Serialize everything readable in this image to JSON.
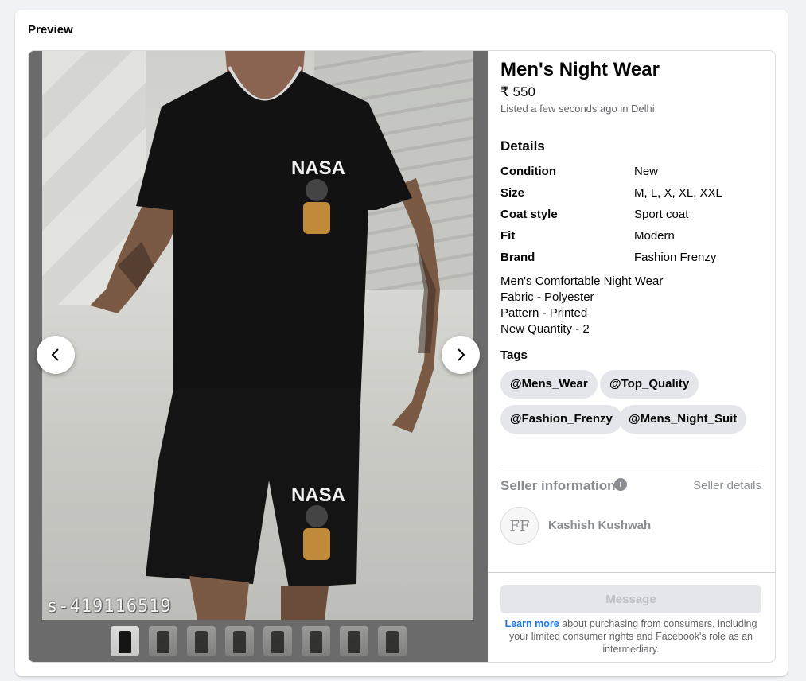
{
  "card": {
    "title": "Preview"
  },
  "media": {
    "watermark": "s-419116519",
    "shirt_print": "NASA",
    "thumbnail_count": 8,
    "active_thumbnail": 1
  },
  "listing": {
    "title": "Men's Night Wear",
    "price": "₹ 550",
    "listed": "Listed a few seconds ago in Delhi",
    "details_heading": "Details",
    "details": [
      {
        "label": "Condition",
        "value": "New"
      },
      {
        "label": "Size",
        "value": "M, L, X, XL, XXL"
      },
      {
        "label": "Coat style",
        "value": "Sport coat"
      },
      {
        "label": "Fit",
        "value": "Modern"
      },
      {
        "label": "Brand",
        "value": "Fashion Frenzy"
      }
    ],
    "description": "Men's Comfortable Night Wear\nFabric - Polyester\nPattern - Printed\nNew Quantity - 2",
    "tags_heading": "Tags",
    "tags": [
      "@Mens_Wear",
      "@Top_Quality",
      "@Fashion_Frenzy",
      "@Mens_Night_Suit"
    ]
  },
  "seller": {
    "heading": "Seller information",
    "details_link": "Seller details",
    "avatar_initials": "FF",
    "name": "Kashish Kushwah"
  },
  "footer": {
    "message_button": "Message",
    "learn_more": "Learn more",
    "disclaimer_rest": " about purchasing from consumers, including your limited consumer rights and Facebook's role as an intermediary."
  }
}
